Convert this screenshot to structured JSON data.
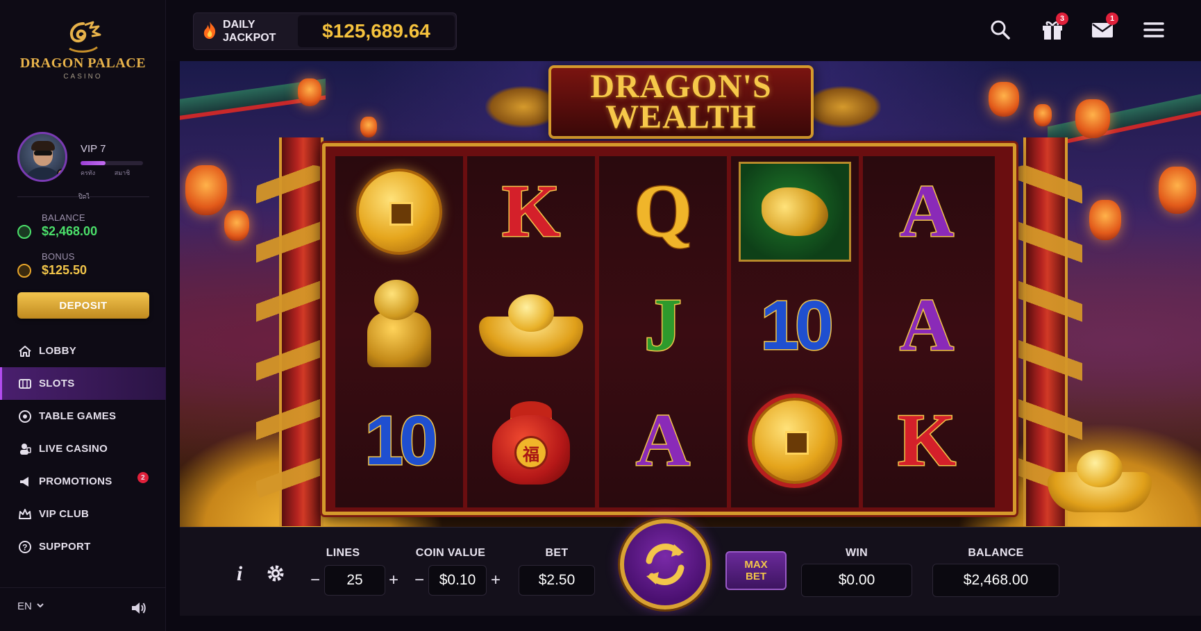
{
  "brand": {
    "name": "DRAGON PALACE",
    "subtitle": "CASINO"
  },
  "profile": {
    "vip_label": "VIP 7",
    "vip_progress": 0.4,
    "vip_bar_text_left": "ครทัง",
    "vip_bar_text_right": "สมาชิ",
    "mark": "ปิดไ"
  },
  "wallet": {
    "balance_label": "BALANCE",
    "balance_value": "$2,468.00",
    "bonus_label": "BONUS",
    "bonus_value": "$125.50",
    "deposit_label": "DEPOSIT"
  },
  "nav": [
    {
      "label": "LOBBY",
      "icon": "home-icon",
      "active": false
    },
    {
      "label": "SLOTS",
      "icon": "slot-machine-icon",
      "active": true
    },
    {
      "label": "TABLE GAMES",
      "icon": "poker-chip-icon",
      "active": false
    },
    {
      "label": "LIVE CASINO",
      "icon": "dealer-icon",
      "active": false
    },
    {
      "label": "PROMOTIONS",
      "icon": "megaphone-icon",
      "active": false,
      "badge": "2"
    },
    {
      "label": "VIP CLUB",
      "icon": "crown-icon",
      "active": false
    },
    {
      "label": "SUPPORT",
      "icon": "headset-icon",
      "active": false
    }
  ],
  "footer": {
    "language": "EN"
  },
  "topbar": {
    "jackpot_label": "DAILY JACKPOT",
    "jackpot_value": "$125,689.64",
    "gift_count": "3",
    "mail_count": "1"
  },
  "game": {
    "title_line1": "DRAGON'S",
    "title_line2": "WEALTH",
    "reels": [
      [
        "gold-coin",
        "lion-statue",
        "10"
      ],
      [
        "K",
        "gold-ingot",
        "lucky-bag"
      ],
      [
        "Q",
        "J",
        "A"
      ],
      [
        "dragon",
        "10",
        "coin-red-ring"
      ],
      [
        "A",
        "A",
        "K"
      ]
    ],
    "bag_glyph": "福"
  },
  "controls": {
    "lines_label": "LINES",
    "lines_value": "25",
    "coin_label": "COIN VALUE",
    "coin_value": "$0.10",
    "bet_label": "BET",
    "bet_value": "$2.50",
    "maxbet_line1": "MAX",
    "maxbet_line2": "BET",
    "win_label": "WIN",
    "win_value": "$0.00",
    "balance_label": "BALANCE",
    "balance_value": "$2,468.00",
    "minus": "−",
    "plus": "+"
  },
  "colors": {
    "accent_gold": "#f5c23d",
    "accent_purple": "#b24cf0",
    "balance_green": "#4be06a",
    "notif_red": "#e0203a"
  }
}
